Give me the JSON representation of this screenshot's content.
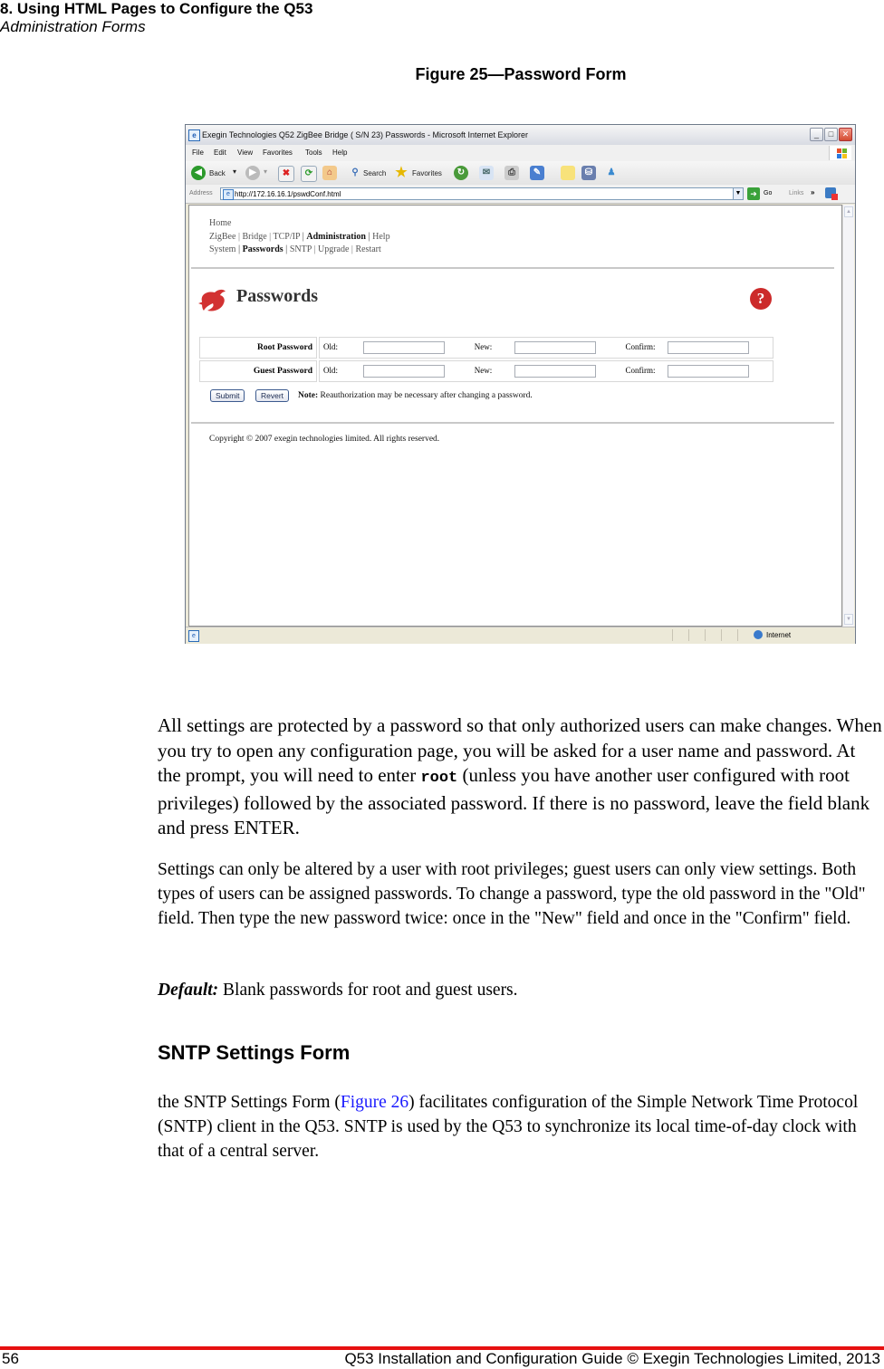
{
  "page_header": {
    "chapter": "8. Using HTML Pages to Configure the Q53",
    "section": "Administration Forms"
  },
  "figure": {
    "caption": "Figure 25—Password Form"
  },
  "browser": {
    "window_title": "Exegin Technologies Q52 ZigBee Bridge ( S/N 23) Passwords - Microsoft Internet Explorer",
    "window_buttons": {
      "minimize": "_",
      "maximize": "□",
      "close": "✕"
    },
    "menu": [
      "File",
      "Edit",
      "View",
      "Favorites",
      "Tools",
      "Help"
    ],
    "toolbar": {
      "back": "Back",
      "search": "Search",
      "favorites": "Favorites"
    },
    "address": {
      "label": "Address",
      "url": "http://172.16.16.1/pswdConf.html",
      "go": "Go",
      "links": "Links",
      "links_chevron": "»"
    },
    "status": {
      "zone": "Internet"
    }
  },
  "webpage": {
    "nav": {
      "home": "Home",
      "row1": [
        "ZigBee",
        "Bridge",
        "TCP/IP",
        "Administration",
        "Help"
      ],
      "row1_active": "Administration",
      "row2": [
        "System",
        "Passwords",
        "SNTP",
        "Upgrade",
        "Restart"
      ],
      "row2_active": "Passwords",
      "separator": "|"
    },
    "title": "Passwords",
    "help_icon": "?",
    "rows": [
      {
        "label": "Root Password",
        "old_label": "Old:",
        "old_value": "",
        "new_label": "New:",
        "new_value": "",
        "confirm_label": "Confirm:",
        "confirm_value": ""
      },
      {
        "label": "Guest Password",
        "old_label": "Old:",
        "old_value": "",
        "new_label": "New:",
        "new_value": "",
        "confirm_label": "Confirm:",
        "confirm_value": ""
      }
    ],
    "buttons": {
      "submit": "Submit",
      "revert": "Revert"
    },
    "note_label": "Note:",
    "note_text": " Reauthorization may be necessary after changing a password.",
    "copyright": "Copyright © 2007 exegin technologies limited. All rights reserved."
  },
  "body": {
    "p1_before": "All settings are protected by a password so that only authorized users can make changes. When you try to open any configuration page, you will be asked for a user name and password. At the prompt, you will need to enter ",
    "p1_code": "root",
    "p1_after": " (unless you have another user configured with root privileges) followed by the associated password. If there is no password, leave the field blank and press ENTER.",
    "p2": "Settings can only be altered by a user with root privileges; guest users can only view settings. Both types of users can be assigned passwords. To change a password, type the old password in the \"Old\" field. Then type the new password twice: once in the \"New\" field and once in the \"Confirm\" field.",
    "default_label": "Default:",
    "default_text": " Blank passwords for root and guest users.",
    "h2": "SNTP Settings Form",
    "p3_before": "the SNTP Settings Form (",
    "p3_link": "Figure 26",
    "p3_after": ") facilitates configuration of the Simple Network Time Protocol (SNTP) client in the Q53. SNTP is used by the Q53 to synchronize its local time-of-day clock with that of a central server."
  },
  "footer": {
    "page_number": "56",
    "text": "Q53 Installation and Configuration Guide  © Exegin Technologies Limited, 2013"
  },
  "colors": {
    "footer_rule": "#e61010",
    "link": "#1a1aff",
    "help_icon": "#cc2a2a"
  }
}
